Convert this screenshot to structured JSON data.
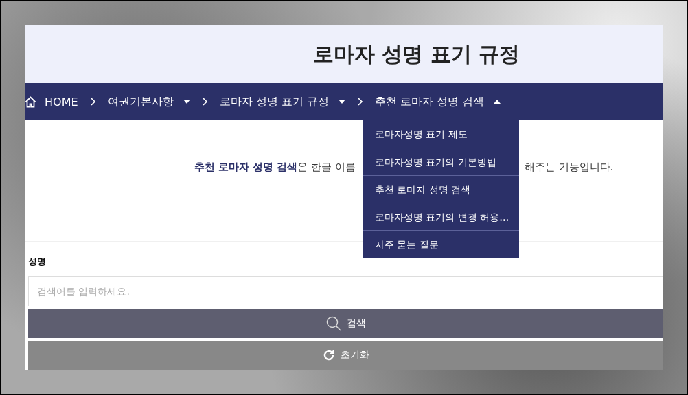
{
  "header": {
    "title": "로마자 성명 표기 규정"
  },
  "breadcrumb": [
    {
      "kind": "home",
      "label": "HOME"
    },
    {
      "kind": "menu",
      "label": "여권기본사항",
      "expanded": false
    },
    {
      "kind": "menu",
      "label": "로마자 성명 표기 규정",
      "expanded": false
    },
    {
      "kind": "menu",
      "label": "추천 로마자 성명 검색",
      "expanded": true
    }
  ],
  "dropdown": {
    "items": [
      {
        "label": "로마자성명 표기 제도"
      },
      {
        "label": "로마자성명 표기의 기본방법"
      },
      {
        "label": "추천 로마자 성명 검색"
      },
      {
        "label": "로마자성명 표기의 변경 허용…"
      },
      {
        "label": "자주 묻는 질문"
      }
    ]
  },
  "intro": {
    "before": "**추천 로마자 성명 검색**은 한글 이름",
    "after": "해주는 기능입니다."
  },
  "form": {
    "label": "성명",
    "placeholder": "검색어를 입력하세요.",
    "search_button": "검색",
    "reset_button": "초기화"
  }
}
